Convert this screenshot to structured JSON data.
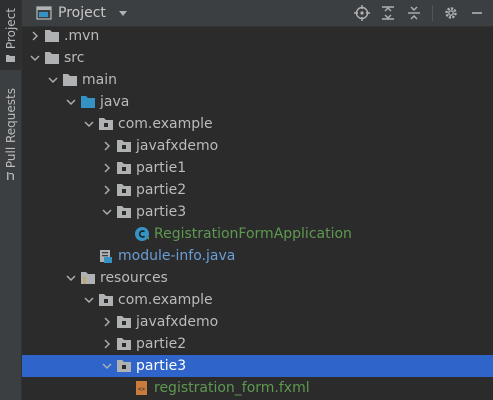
{
  "side_tabs": [
    {
      "label": "Project",
      "icon": "folder-icon",
      "active": true
    },
    {
      "label": "Pull Requests",
      "icon": "pull-request-icon",
      "active": false
    }
  ],
  "header": {
    "title": "Project",
    "title_icon": "project-window-icon",
    "dropdown_icon": "caret-down-icon",
    "tools": [
      "locate-icon",
      "expand-all-icon",
      "collapse-all-icon",
      "settings-icon",
      "hide-icon"
    ]
  },
  "colors": {
    "selection": "#2f65ca",
    "java_text": "#6a9ed7",
    "green_text": "#5d9950",
    "background": "#2b2b2b"
  },
  "tree": [
    {
      "label": ".mvn",
      "depth": 1,
      "expanded": false,
      "icon": "folder-icon"
    },
    {
      "label": "src",
      "depth": 1,
      "expanded": true,
      "icon": "folder-icon"
    },
    {
      "label": "main",
      "depth": 2,
      "expanded": true,
      "icon": "folder-icon"
    },
    {
      "label": "java",
      "depth": 3,
      "expanded": true,
      "icon": "source-folder-icon"
    },
    {
      "label": "com.example",
      "depth": 4,
      "expanded": true,
      "icon": "package-icon"
    },
    {
      "label": "javafxdemo",
      "depth": 5,
      "expanded": false,
      "icon": "package-icon"
    },
    {
      "label": "partie1",
      "depth": 5,
      "expanded": false,
      "icon": "package-icon"
    },
    {
      "label": "partie2",
      "depth": 5,
      "expanded": false,
      "icon": "package-icon"
    },
    {
      "label": "partie3",
      "depth": 5,
      "expanded": true,
      "icon": "package-icon"
    },
    {
      "label": "RegistrationFormApplication",
      "depth": 6,
      "expanded": null,
      "icon": "java-class-icon"
    },
    {
      "label": "module-info.java",
      "depth": 4,
      "expanded": null,
      "icon": "module-info-icon"
    },
    {
      "label": "resources",
      "depth": 3,
      "expanded": true,
      "icon": "resources-folder-icon"
    },
    {
      "label": "com.example",
      "depth": 4,
      "expanded": true,
      "icon": "package-icon"
    },
    {
      "label": "javafxdemo",
      "depth": 5,
      "expanded": false,
      "icon": "package-icon"
    },
    {
      "label": "partie2",
      "depth": 5,
      "expanded": false,
      "icon": "package-icon"
    },
    {
      "label": "partie3",
      "depth": 5,
      "expanded": true,
      "icon": "package-icon",
      "selected": true
    },
    {
      "label": "registration_form.fxml",
      "depth": 6,
      "expanded": null,
      "icon": "fxml-file-icon"
    }
  ]
}
